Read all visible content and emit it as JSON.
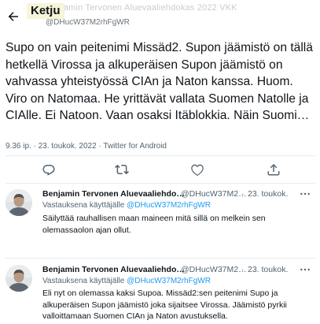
{
  "header": {
    "title": "Ketju",
    "ghost_line_1": "Benjamin Tervonen Aluevaaliehdokas 2022 VKK",
    "ghost_line_2": "@DHucW37M2rhFgWR"
  },
  "main_tweet": {
    "text": "Supo on vain peitenimi Missäd2. Supon jäämistö on tällä hetkellä Virossa ja alkuperäisen Supon jäämistö on vahvassa yhteistyössä CIAn ja Naton kanssa. Huom. Viro on Natomaa. He yrittävät vallata Suomen Natolle ja CIAlle. Ei Natoon. Vaan osaksi Itäblokkia. Näin Suomi…",
    "time": "9.36 ip.",
    "separator": "·",
    "date": "23. toukok. 2022",
    "source": "Twitter for Android"
  },
  "actions": {
    "icons": [
      "reply-icon",
      "retweet-icon",
      "like-icon",
      "share-icon"
    ]
  },
  "replies": [
    {
      "name": "Benjamin Tervonen Aluevaaliehdo…",
      "handle": "@DHucW37M2…",
      "separator": "·",
      "date": "23. toukok.",
      "replying_prefix": "Vastauksena käyttäjälle",
      "replying_to": "@DHucW37M2rhFgWR",
      "text": "Säilyttää rauhallisen maan maineen mitä sillä on melkein sen olemassaolon ajan ollut."
    },
    {
      "name": "Benjamin Tervonen Aluevaaliehdo…",
      "handle": "@DHucW37M2…",
      "separator": "·",
      "date": "23. toukok.",
      "replying_prefix": "Vastauksena käyttäjälle",
      "replying_to": "@DHucW37M2rhFgWR",
      "text": "Eli nyt on olemassa kaksi Supoa. Missäd2:sen peitenimi Supo ja alkuperäisen Supon jäämistö joka sijaitsee Virossa. Jäämistö pyrkii valloittamaan Suomen CIAn ja Naton avustuksella."
    }
  ],
  "colors": {
    "text": "#0f1419",
    "muted": "#536471",
    "link": "#1d9bf0",
    "divider": "#e6ecf0",
    "title_highlight": "#f7f5d7"
  }
}
